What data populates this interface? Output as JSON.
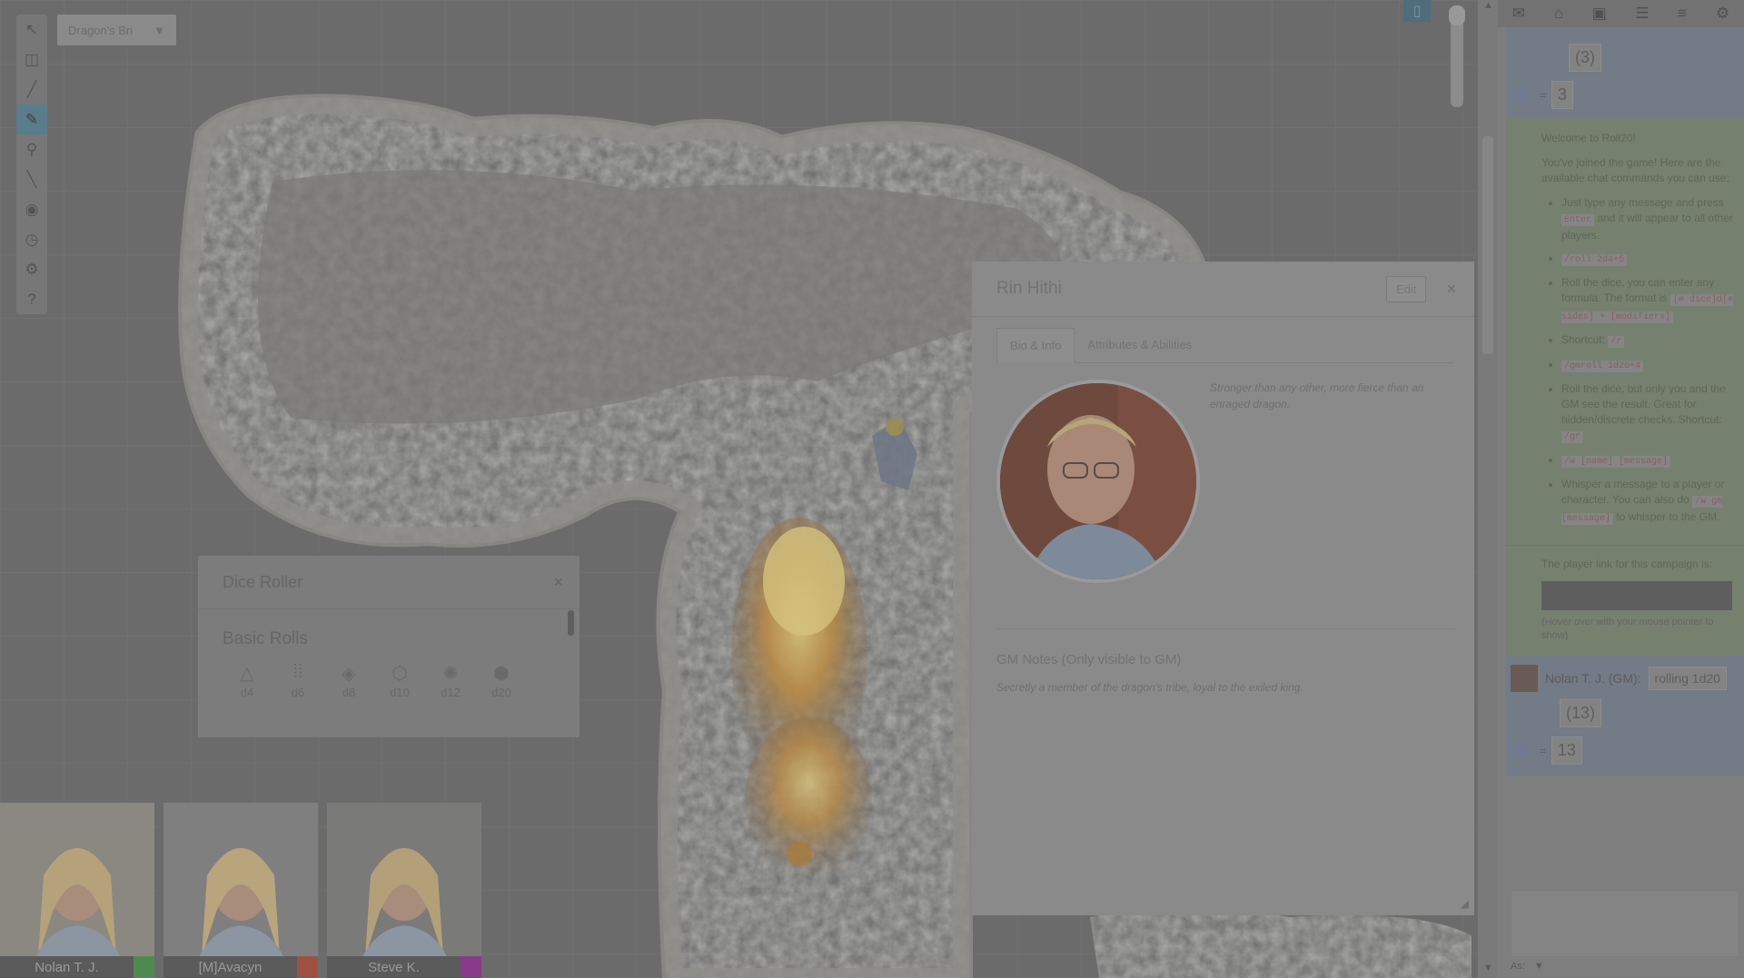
{
  "toolbar": {
    "tools": [
      {
        "name": "select-tool",
        "icon": "cursor-icon",
        "glyph": "↖"
      },
      {
        "name": "map-layer-tool",
        "icon": "layers-icon",
        "glyph": "◫"
      },
      {
        "name": "draw-line-tool",
        "icon": "line-icon",
        "glyph": "╱"
      },
      {
        "name": "fog-reveal-tool",
        "icon": "brush-icon",
        "glyph": "✎"
      },
      {
        "name": "zoom-tool",
        "icon": "magnifier-icon",
        "glyph": "⚲"
      },
      {
        "name": "measure-tool",
        "icon": "ruler-icon",
        "glyph": "╲"
      },
      {
        "name": "fog-of-war-tool",
        "icon": "eye-icon",
        "glyph": "◉"
      },
      {
        "name": "turn-tracker-tool",
        "icon": "clock-icon",
        "glyph": "◷"
      },
      {
        "name": "dice-tool",
        "icon": "dice-icon",
        "glyph": "⚙"
      },
      {
        "name": "help-tool",
        "icon": "help-icon",
        "glyph": "?"
      }
    ]
  },
  "page_select": {
    "label": "Dragon's Bri",
    "arrow": "▼"
  },
  "dice_roller": {
    "title": "Dice Roller",
    "close": "×",
    "section": "Basic Rolls",
    "dice": [
      {
        "label": "d4",
        "glyph": "△"
      },
      {
        "label": "d6",
        "glyph": "⁞⁞"
      },
      {
        "label": "d8",
        "glyph": "◈"
      },
      {
        "label": "d10",
        "glyph": "⬡"
      },
      {
        "label": "d12",
        "glyph": "✺"
      },
      {
        "label": "d20",
        "glyph": "⬢"
      }
    ]
  },
  "character": {
    "name": "Rin Hithi",
    "edit": "Edit",
    "close": "×",
    "tabs": [
      "Bio & Info",
      "Attributes & Abilities"
    ],
    "bio": "Stronger than any other, more fierce than an enraged dragon.",
    "gm_notes_title": "GM Notes (Only visible to GM)",
    "gm_notes": "Secretly a member of the dragon's tribe, loyal to the exiled king."
  },
  "feeds": [
    {
      "name": "Nolan T. J.",
      "color": "#4e8a4e"
    },
    {
      "name": "[M]Avacyn",
      "color": "#a05040"
    },
    {
      "name": "Steve K.",
      "color": "#8a3a8a"
    }
  ],
  "chat": {
    "first_roll": {
      "expr": "(3)",
      "result": "3"
    },
    "welcome": "Welcome to Roll20!",
    "intro": "You've joined the game! Here are the available chat commands you can use:",
    "commands": [
      {
        "pre": "Just type any message and press ",
        "code": "Enter",
        "post": " and it will appear to all other players."
      },
      {
        "pre": "",
        "code": "/roll 2d4+5",
        "post": ""
      },
      {
        "pre": "Roll the dice, you can enter any formula. The format is ",
        "code": "[# dice]d[# sides] + [modifiers]",
        "post": ""
      },
      {
        "pre": "Shortcut: ",
        "code": "/r",
        "post": ""
      },
      {
        "pre": "",
        "code": "/gmroll 1d20+4",
        "post": ""
      },
      {
        "pre": "Roll the dice, but only you and the GM see the result. Great for hidden/discrete checks. Shortcut: ",
        "code": "/gr",
        "post": ""
      },
      {
        "pre": "",
        "code": "/w [name] [message]",
        "post": ""
      },
      {
        "pre": "Whisper a message to a player or character. You can also do ",
        "code": "/w gm [message]",
        "post": " to whisper to the GM."
      }
    ],
    "player_link_label": "The player link for this campaign is:",
    "player_link_hint": "(Hover over with your mouse pointer to show)",
    "second_roll": {
      "speaker": "Nolan T. J. (GM):",
      "text": "rolling 1d20",
      "expr": "(13)",
      "result": "13"
    }
  },
  "sidebar_tabs": [
    "chat-icon",
    "journal-icon",
    "art-icon",
    "compendium-icon",
    "list-icon",
    "settings-icon"
  ]
}
